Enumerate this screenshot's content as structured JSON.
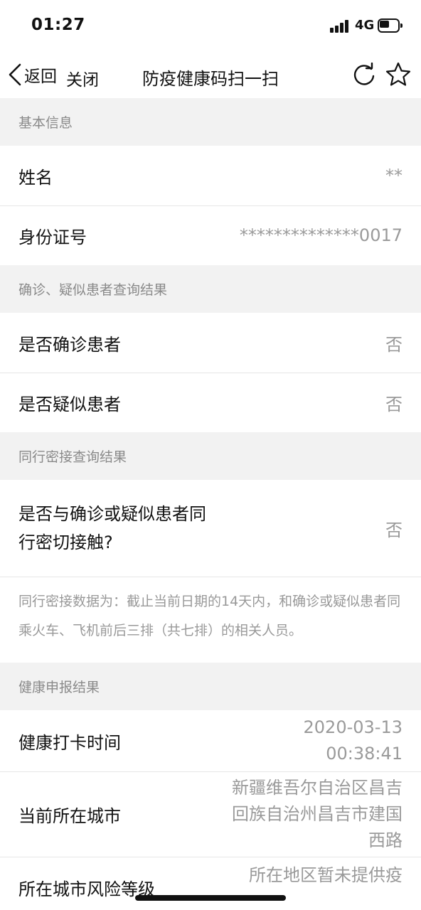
{
  "status_bar": {
    "time": "01:27",
    "network": "4G"
  },
  "nav": {
    "back_label": "返回",
    "close_label": "关闭",
    "title": "防疫健康码扫一扫"
  },
  "sections": {
    "basic": {
      "header": "基本信息",
      "name_label": "姓名",
      "name_value": "**",
      "id_label": "身份证号",
      "id_value": "**************0017"
    },
    "diagnosis": {
      "header": "确诊、疑似患者查询结果",
      "confirmed_label": "是否确诊患者",
      "confirmed_value": "否",
      "suspected_label": "是否疑似患者",
      "suspected_value": "否"
    },
    "contact": {
      "header": "同行密接查询结果",
      "contact_label": "是否与确诊或疑似患者同行密切接触?",
      "contact_value": "否",
      "note": "同行密接数据为：截止当前日期的14天内，和确诊或疑似患者同乘火车、飞机前后三排（共七排）的相关人员。"
    },
    "health": {
      "header": "健康申报结果",
      "checkin_label": "健康打卡时间",
      "checkin_value": "2020-03-13 00:38:41",
      "city_label": "当前所在城市",
      "city_value": "新疆维吾尔自治区昌吉回族自治州昌吉市建国西路",
      "risk_label": "所在城市风险等级",
      "risk_value": "所在地区暂未提供疫"
    }
  },
  "icons": {
    "back": "chevron-left-icon",
    "refresh": "refresh-icon",
    "star": "star-icon"
  }
}
